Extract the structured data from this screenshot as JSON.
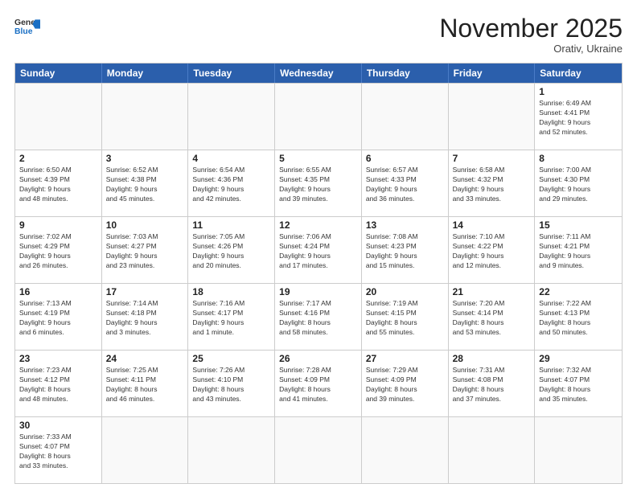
{
  "header": {
    "logo_general": "General",
    "logo_blue": "Blue",
    "month_title": "November 2025",
    "location": "Orativ, Ukraine"
  },
  "weekdays": [
    "Sunday",
    "Monday",
    "Tuesday",
    "Wednesday",
    "Thursday",
    "Friday",
    "Saturday"
  ],
  "rows": [
    [
      {
        "day": "",
        "info": ""
      },
      {
        "day": "",
        "info": ""
      },
      {
        "day": "",
        "info": ""
      },
      {
        "day": "",
        "info": ""
      },
      {
        "day": "",
        "info": ""
      },
      {
        "day": "",
        "info": ""
      },
      {
        "day": "1",
        "info": "Sunrise: 6:49 AM\nSunset: 4:41 PM\nDaylight: 9 hours\nand 52 minutes."
      }
    ],
    [
      {
        "day": "2",
        "info": "Sunrise: 6:50 AM\nSunset: 4:39 PM\nDaylight: 9 hours\nand 48 minutes."
      },
      {
        "day": "3",
        "info": "Sunrise: 6:52 AM\nSunset: 4:38 PM\nDaylight: 9 hours\nand 45 minutes."
      },
      {
        "day": "4",
        "info": "Sunrise: 6:54 AM\nSunset: 4:36 PM\nDaylight: 9 hours\nand 42 minutes."
      },
      {
        "day": "5",
        "info": "Sunrise: 6:55 AM\nSunset: 4:35 PM\nDaylight: 9 hours\nand 39 minutes."
      },
      {
        "day": "6",
        "info": "Sunrise: 6:57 AM\nSunset: 4:33 PM\nDaylight: 9 hours\nand 36 minutes."
      },
      {
        "day": "7",
        "info": "Sunrise: 6:58 AM\nSunset: 4:32 PM\nDaylight: 9 hours\nand 33 minutes."
      },
      {
        "day": "8",
        "info": "Sunrise: 7:00 AM\nSunset: 4:30 PM\nDaylight: 9 hours\nand 29 minutes."
      }
    ],
    [
      {
        "day": "9",
        "info": "Sunrise: 7:02 AM\nSunset: 4:29 PM\nDaylight: 9 hours\nand 26 minutes."
      },
      {
        "day": "10",
        "info": "Sunrise: 7:03 AM\nSunset: 4:27 PM\nDaylight: 9 hours\nand 23 minutes."
      },
      {
        "day": "11",
        "info": "Sunrise: 7:05 AM\nSunset: 4:26 PM\nDaylight: 9 hours\nand 20 minutes."
      },
      {
        "day": "12",
        "info": "Sunrise: 7:06 AM\nSunset: 4:24 PM\nDaylight: 9 hours\nand 17 minutes."
      },
      {
        "day": "13",
        "info": "Sunrise: 7:08 AM\nSunset: 4:23 PM\nDaylight: 9 hours\nand 15 minutes."
      },
      {
        "day": "14",
        "info": "Sunrise: 7:10 AM\nSunset: 4:22 PM\nDaylight: 9 hours\nand 12 minutes."
      },
      {
        "day": "15",
        "info": "Sunrise: 7:11 AM\nSunset: 4:21 PM\nDaylight: 9 hours\nand 9 minutes."
      }
    ],
    [
      {
        "day": "16",
        "info": "Sunrise: 7:13 AM\nSunset: 4:19 PM\nDaylight: 9 hours\nand 6 minutes."
      },
      {
        "day": "17",
        "info": "Sunrise: 7:14 AM\nSunset: 4:18 PM\nDaylight: 9 hours\nand 3 minutes."
      },
      {
        "day": "18",
        "info": "Sunrise: 7:16 AM\nSunset: 4:17 PM\nDaylight: 9 hours\nand 1 minute."
      },
      {
        "day": "19",
        "info": "Sunrise: 7:17 AM\nSunset: 4:16 PM\nDaylight: 8 hours\nand 58 minutes."
      },
      {
        "day": "20",
        "info": "Sunrise: 7:19 AM\nSunset: 4:15 PM\nDaylight: 8 hours\nand 55 minutes."
      },
      {
        "day": "21",
        "info": "Sunrise: 7:20 AM\nSunset: 4:14 PM\nDaylight: 8 hours\nand 53 minutes."
      },
      {
        "day": "22",
        "info": "Sunrise: 7:22 AM\nSunset: 4:13 PM\nDaylight: 8 hours\nand 50 minutes."
      }
    ],
    [
      {
        "day": "23",
        "info": "Sunrise: 7:23 AM\nSunset: 4:12 PM\nDaylight: 8 hours\nand 48 minutes."
      },
      {
        "day": "24",
        "info": "Sunrise: 7:25 AM\nSunset: 4:11 PM\nDaylight: 8 hours\nand 46 minutes."
      },
      {
        "day": "25",
        "info": "Sunrise: 7:26 AM\nSunset: 4:10 PM\nDaylight: 8 hours\nand 43 minutes."
      },
      {
        "day": "26",
        "info": "Sunrise: 7:28 AM\nSunset: 4:09 PM\nDaylight: 8 hours\nand 41 minutes."
      },
      {
        "day": "27",
        "info": "Sunrise: 7:29 AM\nSunset: 4:09 PM\nDaylight: 8 hours\nand 39 minutes."
      },
      {
        "day": "28",
        "info": "Sunrise: 7:31 AM\nSunset: 4:08 PM\nDaylight: 8 hours\nand 37 minutes."
      },
      {
        "day": "29",
        "info": "Sunrise: 7:32 AM\nSunset: 4:07 PM\nDaylight: 8 hours\nand 35 minutes."
      }
    ],
    [
      {
        "day": "30",
        "info": "Sunrise: 7:33 AM\nSunset: 4:07 PM\nDaylight: 8 hours\nand 33 minutes."
      },
      {
        "day": "",
        "info": ""
      },
      {
        "day": "",
        "info": ""
      },
      {
        "day": "",
        "info": ""
      },
      {
        "day": "",
        "info": ""
      },
      {
        "day": "",
        "info": ""
      },
      {
        "day": "",
        "info": ""
      }
    ]
  ]
}
